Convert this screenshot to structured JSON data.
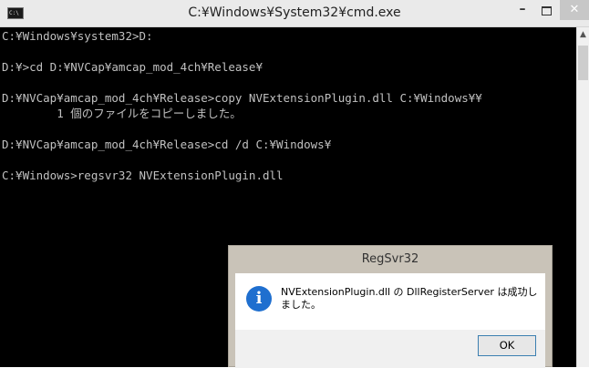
{
  "window": {
    "title": "C:¥Windows¥System32¥cmd.exe",
    "icon_label": "C:\\",
    "minimize": "–",
    "close": "✕"
  },
  "console": {
    "lines": [
      "C:¥Windows¥system32>D:",
      "",
      "D:¥>cd D:¥NVCap¥amcap_mod_4ch¥Release¥",
      "",
      "D:¥NVCap¥amcap_mod_4ch¥Release>copy NVExtensionPlugin.dll C:¥Windows¥¥",
      "        1 個のファイルをコピーしました。",
      "",
      "D:¥NVCap¥amcap_mod_4ch¥Release>cd /d C:¥Windows¥",
      "",
      "C:¥Windows>regsvr32 NVExtensionPlugin.dll"
    ]
  },
  "scrollbar": {
    "up_arrow": "▲"
  },
  "dialog": {
    "title": "RegSvr32",
    "icon_glyph": "i",
    "message_line1": "NVExtensionPlugin.dll の DllRegisterServer は成功し",
    "message_line2": "ました。",
    "ok_label": "OK"
  }
}
